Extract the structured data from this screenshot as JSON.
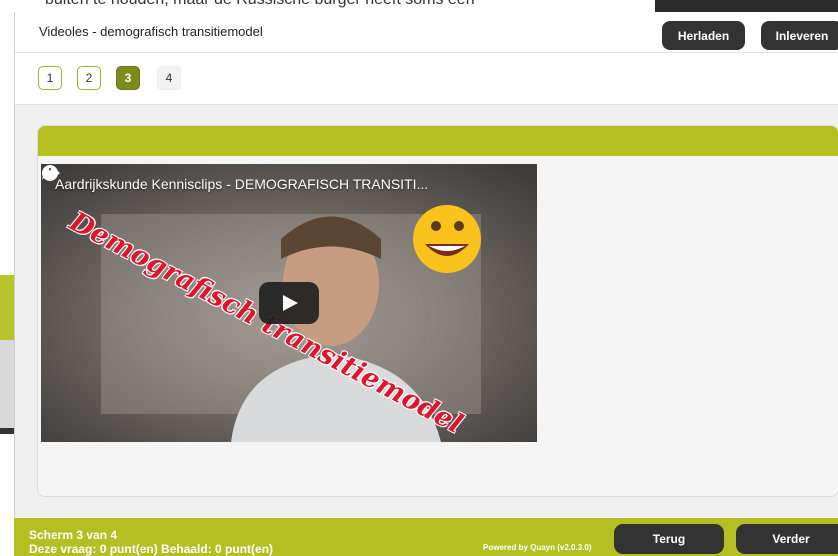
{
  "background": {
    "text_snippet": "buiten te houden, maar de Russische burger heeft soms een"
  },
  "modal": {
    "title": "Videoles - demografisch transitiemodel",
    "reload_label": "Herladen",
    "submit_label": "Inleveren"
  },
  "pager": {
    "pages": [
      "1",
      "2",
      "3",
      "4"
    ],
    "active_page": "3"
  },
  "video": {
    "title": "Aardrijkskunde Kennisclips - DEMOGRAFISCH TRANSITI...",
    "watermark": "Demografisch transitiemodel",
    "icons": [
      "clock-icon",
      "share-icon",
      "play-icon",
      "smiley-emoji"
    ]
  },
  "footer": {
    "screen_status": "Scherm 3 van 4",
    "points_status": "Deze vraag: 0 punt(en)   Behaald: 0 punt(en)",
    "powered_by": "Powered by Quayn (v2.0.3.0)",
    "back_label": "Terug",
    "next_label": "Verder"
  },
  "colors": {
    "accent_green": "#b4bf22",
    "active_page_green": "#7d8a1c",
    "button_dark": "#333333"
  }
}
